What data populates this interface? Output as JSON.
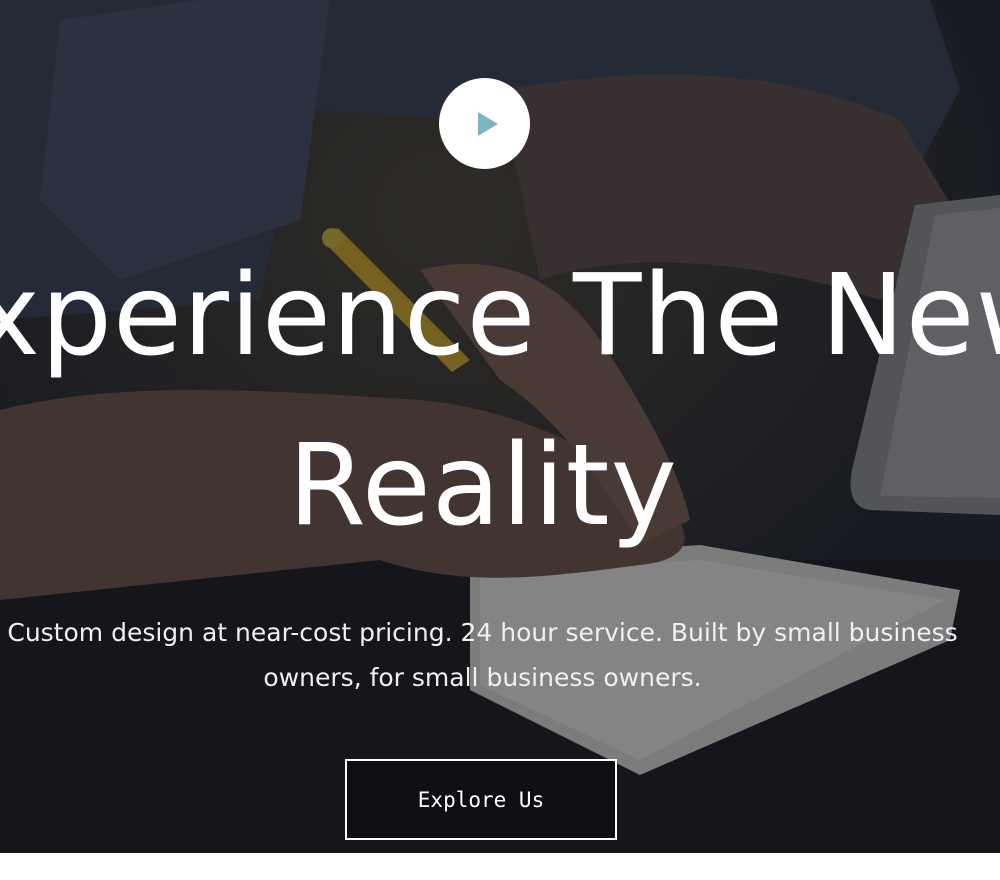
{
  "hero": {
    "play_icon": "play-icon",
    "headline_line1": "Experience The New",
    "headline_line2": "Reality",
    "subtitle_line1": "Custom design at near-cost pricing. 24 hour service. Built by small business",
    "subtitle_line2": "owners, for small business owners.",
    "cta_label": "Explore Us"
  },
  "colors": {
    "overlay": "#23262d",
    "play_accent": "#7bb6c4",
    "text": "#ffffff"
  }
}
